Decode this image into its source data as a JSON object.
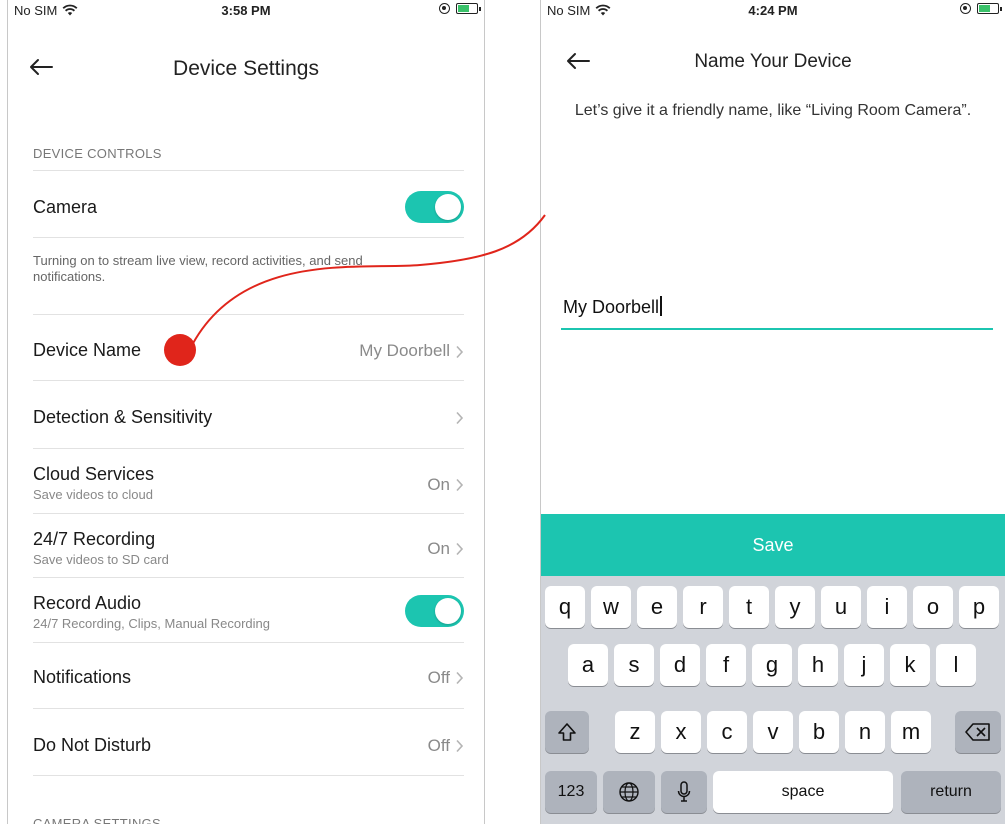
{
  "left": {
    "status": {
      "carrier": "No SIM",
      "time": "3:58 PM"
    },
    "title": "Device Settings",
    "section_device_controls": "DEVICE CONTROLS",
    "camera_label": "Camera",
    "camera_toggle": true,
    "camera_desc": "Turning on to stream live view, record activities, and send notifications.",
    "device_name_label": "Device Name",
    "device_name_value": "My Doorbell",
    "detection_label": "Detection & Sensitivity",
    "cloud_label": "Cloud Services",
    "cloud_sub": "Save videos to cloud",
    "cloud_value": "On",
    "recording_label": "24/7 Recording",
    "recording_sub": "Save videos to SD card",
    "recording_value": "On",
    "audio_label": "Record Audio",
    "audio_sub": "24/7 Recording, Clips, Manual Recording",
    "audio_toggle": true,
    "notifications_label": "Notifications",
    "notifications_value": "Off",
    "dnd_label": "Do Not Disturb",
    "dnd_value": "Off",
    "section_camera_settings": "CAMERA SETTINGS"
  },
  "right": {
    "status": {
      "carrier": "No SIM",
      "time": "4:24 PM"
    },
    "title": "Name Your Device",
    "instruction": "Let’s give it a friendly name, like “Living Room Camera”.",
    "input_value": "My Doorbell",
    "save_label": "Save",
    "keyboard": {
      "row1": [
        "q",
        "w",
        "e",
        "r",
        "t",
        "y",
        "u",
        "i",
        "o",
        "p"
      ],
      "row2": [
        "a",
        "s",
        "d",
        "f",
        "g",
        "h",
        "j",
        "k",
        "l"
      ],
      "row3": [
        "z",
        "x",
        "c",
        "v",
        "b",
        "n",
        "m"
      ],
      "numbers_key": "123",
      "space_key": "space",
      "return_key": "return"
    }
  },
  "colors": {
    "accent": "#1cc5b0",
    "annotation": "#e0251b"
  }
}
